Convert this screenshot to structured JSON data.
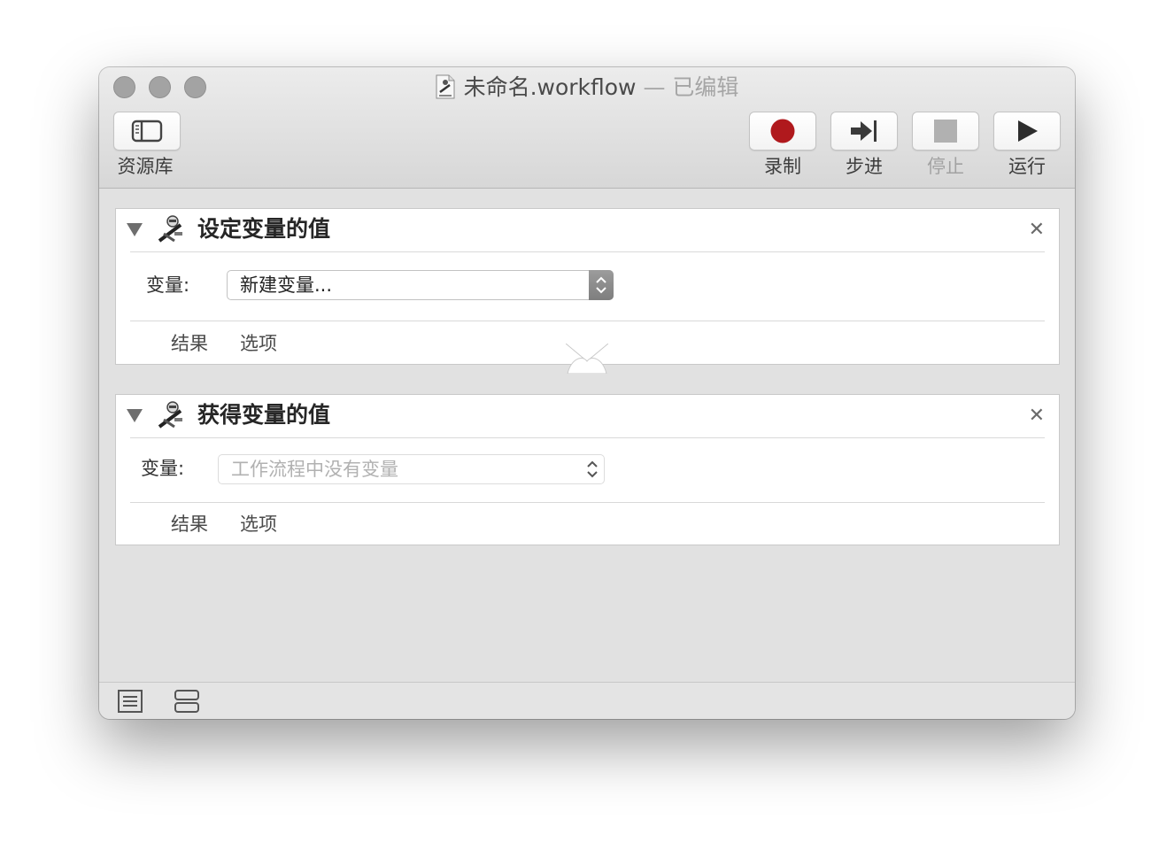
{
  "window": {
    "title": "未命名.workflow",
    "title_separator": " — ",
    "edited_label": "已编辑"
  },
  "toolbar": {
    "library_label": "资源库",
    "record_label": "录制",
    "step_label": "步进",
    "stop_label": "停止",
    "run_label": "运行",
    "record_color": "#b0191d"
  },
  "actions": [
    {
      "title": "设定变量的值",
      "variable_label": "变量:",
      "variable_value": "新建变量...",
      "results_label": "结果",
      "options_label": "选项"
    },
    {
      "title": "获得变量的值",
      "variable_label": "变量:",
      "variable_placeholder": "工作流程中没有变量",
      "results_label": "结果",
      "options_label": "选项"
    }
  ],
  "bottom_bar": {
    "icons": [
      "list-view-icon",
      "workflow-view-icon"
    ]
  }
}
